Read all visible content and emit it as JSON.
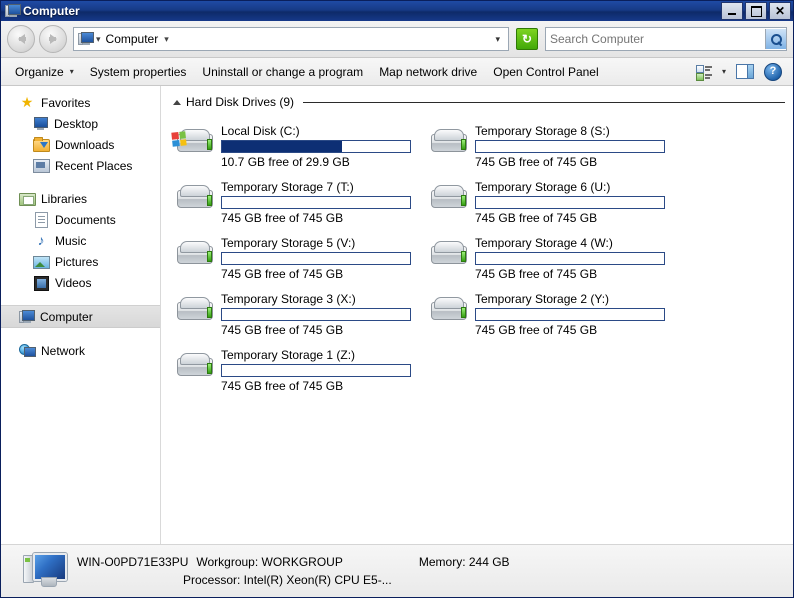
{
  "window": {
    "title": "Computer",
    "title_icon": "computer-icon",
    "buttons": {
      "minimize": "_",
      "maximize": "□",
      "close": "✕"
    }
  },
  "nav": {
    "back_icon": "arrow-left-icon",
    "forward_icon": "arrow-right-icon",
    "address_icon": "computer-icon",
    "crumb": "Computer",
    "crumb_caret": "▾",
    "address_dropdown": "▾",
    "refresh_icon": "refresh-icon",
    "refresh_glyph": "↻"
  },
  "search": {
    "value": "",
    "placeholder": "Search Computer",
    "button_icon": "magnifier-icon"
  },
  "toolbar": {
    "items": [
      {
        "label": "Organize",
        "caret": "▾"
      },
      {
        "label": "System properties",
        "caret": ""
      },
      {
        "label": "Uninstall or change a program",
        "caret": ""
      },
      {
        "label": "Map network drive",
        "caret": ""
      },
      {
        "label": "Open Control Panel",
        "caret": ""
      }
    ],
    "views_icon": "views-icon",
    "views_caret": "▾",
    "preview_pane_icon": "preview-pane-icon",
    "help_label": "?"
  },
  "sidebar": {
    "groups": [
      {
        "label": "Favorites",
        "icon": "star-icon",
        "items": [
          {
            "label": "Desktop",
            "icon": "desktop-icon"
          },
          {
            "label": "Downloads",
            "icon": "downloads-icon"
          },
          {
            "label": "Recent Places",
            "icon": "recent-places-icon"
          }
        ]
      },
      {
        "label": "Libraries",
        "icon": "libraries-icon",
        "items": [
          {
            "label": "Documents",
            "icon": "documents-icon"
          },
          {
            "label": "Music",
            "icon": "music-icon"
          },
          {
            "label": "Pictures",
            "icon": "pictures-icon"
          },
          {
            "label": "Videos",
            "icon": "videos-icon"
          }
        ]
      }
    ],
    "computer": {
      "label": "Computer",
      "icon": "computer-icon",
      "selected": true
    },
    "network": {
      "label": "Network",
      "icon": "network-icon"
    }
  },
  "content": {
    "group_label": "Hard Disk Drives (9)",
    "drives": [
      {
        "name": "Local Disk (C:)",
        "free_text": "10.7 GB free of 29.9 GB",
        "used_percent": 64,
        "icon": "hard-drive-windows-icon"
      },
      {
        "name": "Temporary Storage 8 (S:)",
        "free_text": "745 GB free of 745 GB",
        "used_percent": 0,
        "icon": "hard-drive-icon"
      },
      {
        "name": "Temporary Storage 7 (T:)",
        "free_text": "745 GB free of 745 GB",
        "used_percent": 0,
        "icon": "hard-drive-icon"
      },
      {
        "name": "Temporary Storage 6 (U:)",
        "free_text": "745 GB free of 745 GB",
        "used_percent": 0,
        "icon": "hard-drive-icon"
      },
      {
        "name": "Temporary Storage 5 (V:)",
        "free_text": "745 GB free of 745 GB",
        "used_percent": 0,
        "icon": "hard-drive-icon"
      },
      {
        "name": "Temporary Storage 4 (W:)",
        "free_text": "745 GB free of 745 GB",
        "used_percent": 0,
        "icon": "hard-drive-icon"
      },
      {
        "name": "Temporary Storage 3 (X:)",
        "free_text": "745 GB free of 745 GB",
        "used_percent": 0,
        "icon": "hard-drive-icon"
      },
      {
        "name": "Temporary Storage 2 (Y:)",
        "free_text": "745 GB free of 745 GB",
        "used_percent": 0,
        "icon": "hard-drive-icon"
      },
      {
        "name": "Temporary Storage 1 (Z:)",
        "free_text": "745 GB free of 745 GB",
        "used_percent": 0,
        "icon": "hard-drive-icon"
      }
    ]
  },
  "status": {
    "icon": "computer-icon",
    "computer_name": "WIN-O0PD71E33PU",
    "workgroup": "Workgroup: WORKGROUP",
    "memory": "Memory:  244 GB",
    "processor": "Processor:  Intel(R) Xeon(R) CPU E5-..."
  },
  "colors": {
    "titlebar": "#16398a",
    "meter_fill": "#0d2f74",
    "meter_border": "#2b4a86",
    "selection": "#dcdcdc"
  }
}
